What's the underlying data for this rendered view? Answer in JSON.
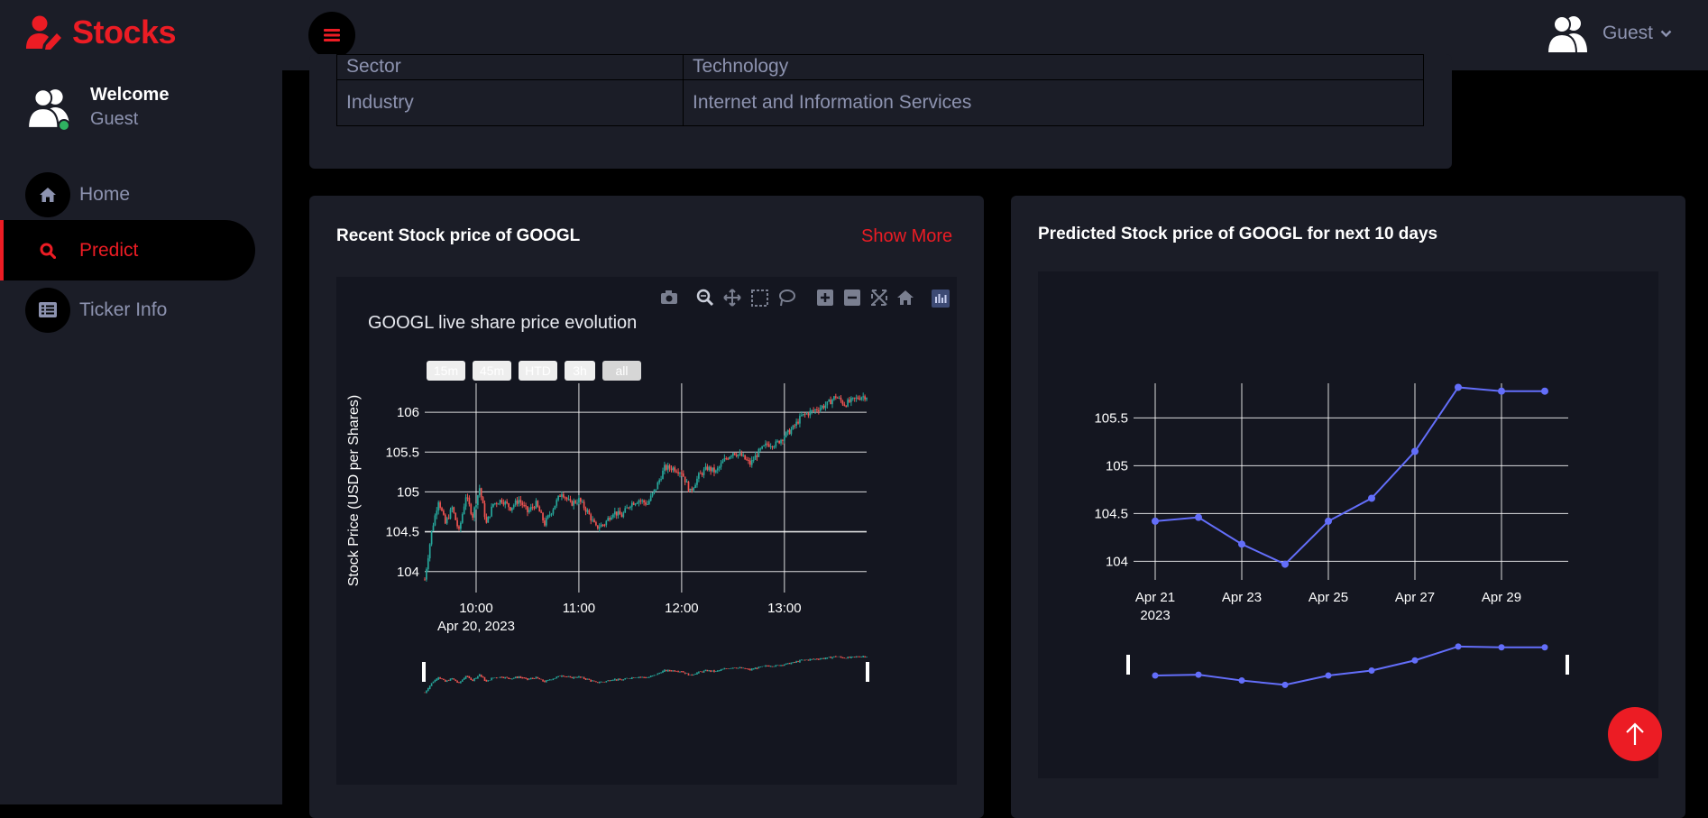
{
  "brand": {
    "name": "Stocks"
  },
  "header": {
    "user_label": "Guest"
  },
  "sidebar": {
    "welcome_title": "Welcome",
    "welcome_user": "Guest",
    "items": [
      {
        "label": "Home",
        "icon": "home-icon"
      },
      {
        "label": "Predict",
        "icon": "search-icon",
        "active": true
      },
      {
        "label": "Ticker Info",
        "icon": "list-icon"
      }
    ]
  },
  "info_table": {
    "rows": [
      {
        "key": "Sector",
        "value": "Technology"
      },
      {
        "key": "Industry",
        "value": "Internet and Information Services"
      }
    ]
  },
  "recent_card": {
    "title": "Recent Stock price of GOOGL",
    "show_more": "Show More",
    "range_buttons": [
      "15m",
      "45m",
      "HTD",
      "3h",
      "all"
    ]
  },
  "predicted_card": {
    "title": "Predicted Stock price of GOOGL for next 10 days"
  },
  "colors": {
    "accent": "#ec1c24",
    "panel": "#1b1d27",
    "muted_text": "#8d93b0",
    "increasing": "#26a69a",
    "decreasing": "#ef5350",
    "prediction_line": "#636efa"
  },
  "chart_data": [
    {
      "type": "candlestick",
      "title": "GOOGL live share price evolution",
      "ylabel": "Stock Price (USD per Shares)",
      "xlabel": "",
      "x_ticks": [
        "10:00",
        "11:00",
        "12:00",
        "13:00"
      ],
      "x_date_label": "Apr 20, 2023",
      "y_ticks": [
        104,
        104.5,
        105,
        105.5,
        106
      ],
      "xlim": [
        "09:30",
        "13:48"
      ],
      "ylim": [
        103.85,
        106.25
      ],
      "grid": true,
      "close_trend": [
        {
          "t": "09:30",
          "v": 103.9
        },
        {
          "t": "09:34",
          "v": 104.5
        },
        {
          "t": "09:38",
          "v": 104.9
        },
        {
          "t": "09:42",
          "v": 104.6
        },
        {
          "t": "09:46",
          "v": 104.8
        },
        {
          "t": "09:50",
          "v": 104.5
        },
        {
          "t": "09:54",
          "v": 104.95
        },
        {
          "t": "09:58",
          "v": 104.7
        },
        {
          "t": "10:02",
          "v": 105.05
        },
        {
          "t": "10:06",
          "v": 104.6
        },
        {
          "t": "10:10",
          "v": 104.85
        },
        {
          "t": "10:15",
          "v": 104.9
        },
        {
          "t": "10:20",
          "v": 104.8
        },
        {
          "t": "10:25",
          "v": 104.9
        },
        {
          "t": "10:30",
          "v": 104.75
        },
        {
          "t": "10:35",
          "v": 104.85
        },
        {
          "t": "10:40",
          "v": 104.6
        },
        {
          "t": "10:45",
          "v": 104.8
        },
        {
          "t": "10:50",
          "v": 105.0
        },
        {
          "t": "10:55",
          "v": 104.85
        },
        {
          "t": "11:00",
          "v": 104.9
        },
        {
          "t": "11:05",
          "v": 104.75
        },
        {
          "t": "11:10",
          "v": 104.55
        },
        {
          "t": "11:15",
          "v": 104.6
        },
        {
          "t": "11:20",
          "v": 104.75
        },
        {
          "t": "11:25",
          "v": 104.7
        },
        {
          "t": "11:30",
          "v": 104.85
        },
        {
          "t": "11:35",
          "v": 104.9
        },
        {
          "t": "11:40",
          "v": 104.85
        },
        {
          "t": "11:45",
          "v": 105.05
        },
        {
          "t": "11:50",
          "v": 105.3
        },
        {
          "t": "11:55",
          "v": 105.3
        },
        {
          "t": "12:00",
          "v": 105.25
        },
        {
          "t": "12:05",
          "v": 105.0
        },
        {
          "t": "12:10",
          "v": 105.2
        },
        {
          "t": "12:15",
          "v": 105.3
        },
        {
          "t": "12:20",
          "v": 105.25
        },
        {
          "t": "12:25",
          "v": 105.4
        },
        {
          "t": "12:30",
          "v": 105.5
        },
        {
          "t": "12:35",
          "v": 105.45
        },
        {
          "t": "12:40",
          "v": 105.35
        },
        {
          "t": "12:45",
          "v": 105.5
        },
        {
          "t": "12:50",
          "v": 105.6
        },
        {
          "t": "12:55",
          "v": 105.6
        },
        {
          "t": "13:00",
          "v": 105.7
        },
        {
          "t": "13:05",
          "v": 105.8
        },
        {
          "t": "13:10",
          "v": 105.95
        },
        {
          "t": "13:15",
          "v": 106.0
        },
        {
          "t": "13:20",
          "v": 106.05
        },
        {
          "t": "13:25",
          "v": 106.1
        },
        {
          "t": "13:30",
          "v": 106.2
        },
        {
          "t": "13:35",
          "v": 106.1
        },
        {
          "t": "13:40",
          "v": 106.15
        },
        {
          "t": "13:45",
          "v": 106.2
        }
      ]
    },
    {
      "type": "line",
      "title": "",
      "xlabel": "",
      "ylabel": "",
      "x": [
        "Apr 21",
        "Apr 22",
        "Apr 23",
        "Apr 24",
        "Apr 25",
        "Apr 26",
        "Apr 27",
        "Apr 28",
        "Apr 29",
        "Apr 30"
      ],
      "values": [
        104.42,
        104.46,
        104.18,
        103.97,
        104.42,
        104.66,
        105.15,
        105.82,
        105.78,
        105.78
      ],
      "x_ticks": [
        "Apr 21",
        "Apr 23",
        "Apr 25",
        "Apr 27",
        "Apr 29"
      ],
      "x_year_label": "2023",
      "y_ticks": [
        104,
        104.5,
        105,
        105.5
      ],
      "ylim": [
        103.9,
        105.9
      ],
      "grid": true
    }
  ]
}
